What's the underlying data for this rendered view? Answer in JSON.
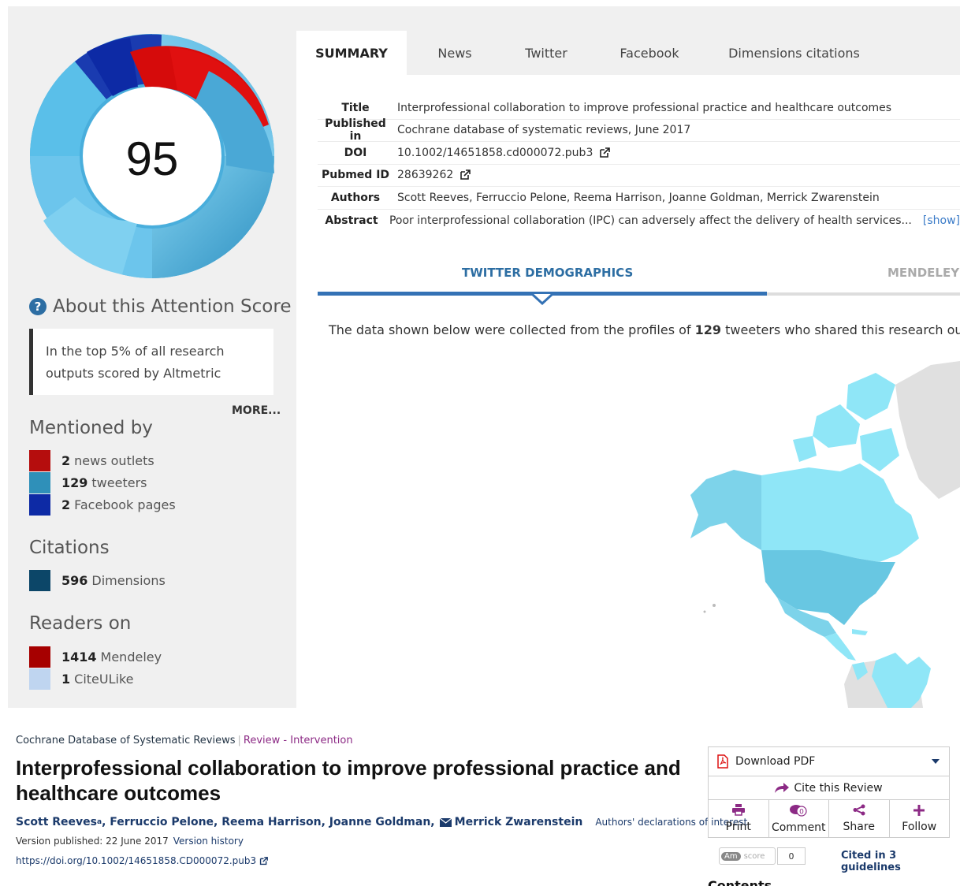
{
  "altmetric": {
    "score": "95",
    "about_title": "About this Attention Score",
    "top_text": "In the top 5% of all research outputs scored by Altmetric",
    "more": "MORE...",
    "mentioned_title": "Mentioned by",
    "mentioned": [
      {
        "count": "2",
        "label": "news outlets",
        "color": "#b50d0d"
      },
      {
        "count": "129",
        "label": "tweeters",
        "color": "#2f90b9"
      },
      {
        "count": "2",
        "label": "Facebook pages",
        "color": "#0d2aa5"
      }
    ],
    "citations_title": "Citations",
    "citations": [
      {
        "count": "596",
        "label": "Dimensions",
        "color": "#0c4668"
      }
    ],
    "readers_title": "Readers on",
    "readers": [
      {
        "count": "1414",
        "label": "Mendeley",
        "color": "#a60000"
      },
      {
        "count": "1",
        "label": "CiteULike",
        "color": "#bfd5f0"
      }
    ],
    "tabs": [
      {
        "label": "SUMMARY",
        "active": true
      },
      {
        "label": "News"
      },
      {
        "label": "Twitter"
      },
      {
        "label": "Facebook"
      },
      {
        "label": "Dimensions citations"
      }
    ],
    "meta": {
      "title_label": "Title",
      "title_value": "Interprofessional collaboration to improve professional practice and healthcare outcomes",
      "published_label": "Published in",
      "published_value": "Cochrane database of systematic reviews, June 2017",
      "doi_label": "DOI",
      "doi_value": "10.1002/14651858.cd000072.pub3",
      "pubmed_label": "Pubmed ID",
      "pubmed_value": "28639262",
      "authors_label": "Authors",
      "authors_value": "Scott Reeves, Ferruccio Pelone, Reema Harrison, Joanne Goldman, Merrick Zwarenstein",
      "abstract_label": "Abstract",
      "abstract_value": "Poor interprofessional collaboration (IPC) can adversely affect the delivery of health services...",
      "abstract_show": "[show]"
    },
    "demo": {
      "twitter_tab": "TWITTER DEMOGRAPHICS",
      "mendeley_tab": "MENDELEY",
      "text_before": "The data shown below were collected from the profiles of ",
      "count": "129",
      "text_after": " tweeters who shared this research output."
    }
  },
  "cochrane": {
    "journal": "Cochrane Database of Systematic Reviews",
    "type": "Review - Intervention",
    "title": "Interprofessional collaboration to improve professional practice and healthcare outcomes",
    "author_first": "Scott Reeves",
    "author_first_sup": "a",
    "authors_rest": ", Ferruccio Pelone, Reema Harrison, Joanne Goldman,",
    "author_contact": "Merrick Zwarenstein",
    "declarations": "Authors' declarations of interest",
    "version_published": "Version published: 22 June 2017",
    "version_history": "Version history",
    "doi_url": "https://doi.org/10.1002/14651858.CD000072.pub3",
    "download_pdf": "Download PDF",
    "cite_review": "Cite this Review",
    "actions": [
      {
        "label": "Print",
        "icon": "print-icon"
      },
      {
        "label": "Comment",
        "icon": "comment-icon",
        "badge": "0"
      },
      {
        "label": "Share",
        "icon": "share-icon"
      },
      {
        "label": "Follow",
        "icon": "plus-icon"
      }
    ],
    "am_label": "Am",
    "am_score_label": "score",
    "am_count": "0",
    "cited_guidelines": "Cited in 3 guidelines",
    "contents_heading": "Contents"
  }
}
